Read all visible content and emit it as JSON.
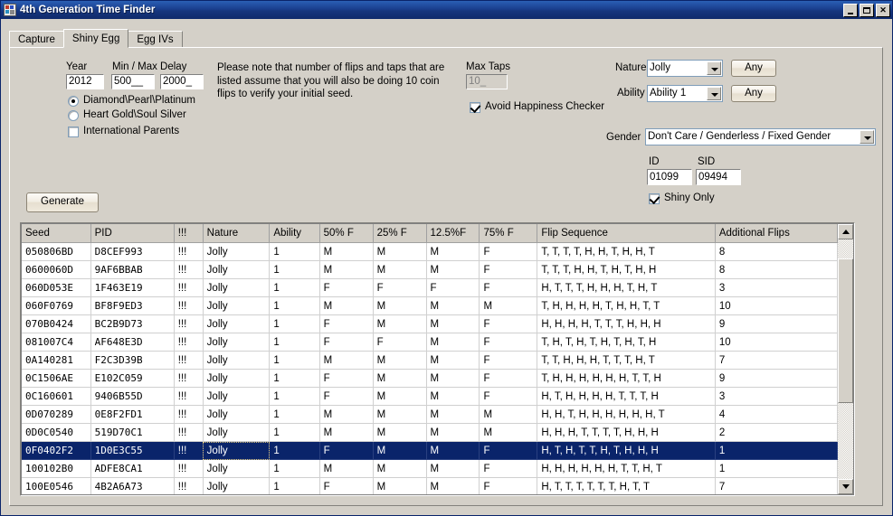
{
  "window": {
    "title": "4th Generation Time Finder",
    "icon": "app-icon",
    "buttons": {
      "minimize": "_",
      "maximize": "□",
      "close": "✕"
    }
  },
  "tabs": [
    {
      "label": "Capture",
      "active": false
    },
    {
      "label": "Shiny Egg",
      "active": true
    },
    {
      "label": "Egg IVs",
      "active": false
    }
  ],
  "form": {
    "year_label": "Year",
    "year_value": "2012",
    "delay_label": "Min / Max Delay",
    "min_delay_value": "500__",
    "max_delay_value": "2000_",
    "radio_dpp": "Diamond\\Pearl\\Platinum",
    "radio_hgss": "Heart Gold\\Soul Silver",
    "check_international": "International Parents",
    "note": "Please note that number of flips and taps that are listed assume that you will also be doing 10 coin flips to verify your initial seed.",
    "max_taps_label": "Max Taps",
    "max_taps_value": "10_",
    "avoid_happiness": "Avoid Happiness Checker",
    "nature_label": "Nature",
    "nature_value": "Jolly",
    "nature_any": "Any",
    "ability_label": "Ability",
    "ability_value": "Ability 1",
    "ability_any": "Any",
    "gender_label": "Gender",
    "gender_value": "Don't Care / Genderless / Fixed Gender",
    "id_label": "ID",
    "id_value": "01099",
    "sid_label": "SID",
    "sid_value": "09494",
    "shiny_only": "Shiny Only",
    "generate": "Generate"
  },
  "grid": {
    "columns": [
      "Seed",
      "PID",
      "!!!",
      "Nature",
      "Ability",
      "50% F",
      "25% F",
      "12.5%F",
      "75% F",
      "Flip Sequence",
      "Additional Flips"
    ],
    "selected_row": 11,
    "rows": [
      [
        "050806BD",
        "D8CEF993",
        "!!!",
        "Jolly",
        "1",
        "M",
        "M",
        "M",
        "F",
        "T, T, T, T, H, H, T, H, H, T",
        "8"
      ],
      [
        "0600060D",
        "9AF6BBAB",
        "!!!",
        "Jolly",
        "1",
        "M",
        "M",
        "M",
        "F",
        "T, T, T, H, H, T, H, T, H, H",
        "8"
      ],
      [
        "060D053E",
        "1F463E19",
        "!!!",
        "Jolly",
        "1",
        "F",
        "F",
        "F",
        "F",
        "H, T, T, T, H, H, H, T, H, T",
        "3"
      ],
      [
        "060F0769",
        "BF8F9ED3",
        "!!!",
        "Jolly",
        "1",
        "M",
        "M",
        "M",
        "M",
        "T, H, H, H, H, T, H, H, T, T",
        "10"
      ],
      [
        "070B0424",
        "BC2B9D73",
        "!!!",
        "Jolly",
        "1",
        "F",
        "M",
        "M",
        "F",
        "H, H, H, H, T, T, T, H, H, H",
        "9"
      ],
      [
        "081007C4",
        "AF648E3D",
        "!!!",
        "Jolly",
        "1",
        "F",
        "F",
        "M",
        "F",
        "T, H, T, H, T, H, T, H, T, H",
        "10"
      ],
      [
        "0A140281",
        "F2C3D39B",
        "!!!",
        "Jolly",
        "1",
        "M",
        "M",
        "M",
        "F",
        "T, T, H, H, H, T, T, T, H, T",
        "7"
      ],
      [
        "0C1506AE",
        "E102C059",
        "!!!",
        "Jolly",
        "1",
        "F",
        "M",
        "M",
        "F",
        "T, H, H, H, H, H, H, T, T, H",
        "9"
      ],
      [
        "0C160601",
        "9406B55D",
        "!!!",
        "Jolly",
        "1",
        "F",
        "M",
        "M",
        "F",
        "H, T, H, H, H, H, T, T, T, H",
        "3"
      ],
      [
        "0D070289",
        "0E8F2FD1",
        "!!!",
        "Jolly",
        "1",
        "M",
        "M",
        "M",
        "M",
        "H, H, T, H, H, H, H, H, H, T",
        "4"
      ],
      [
        "0D0C0540",
        "519D70C1",
        "!!!",
        "Jolly",
        "1",
        "M",
        "M",
        "M",
        "M",
        "H, H, H, T, T, T, T, H, H, H",
        "2"
      ],
      [
        "0F0402F2",
        "1D0E3C55",
        "!!!",
        "Jolly",
        "1",
        "F",
        "M",
        "M",
        "F",
        "H, T, H, T, T, H, T, H, H, H",
        "1"
      ],
      [
        "100102B0",
        "ADFE8CA1",
        "!!!",
        "Jolly",
        "1",
        "M",
        "M",
        "M",
        "F",
        "H, H, H, H, H, H, T, T, H, T",
        "1"
      ],
      [
        "100E0546",
        "4B2A6A73",
        "!!!",
        "Jolly",
        "1",
        "F",
        "M",
        "M",
        "F",
        "H, T, T, T, T, T, T, H, T, T",
        "7"
      ]
    ]
  }
}
